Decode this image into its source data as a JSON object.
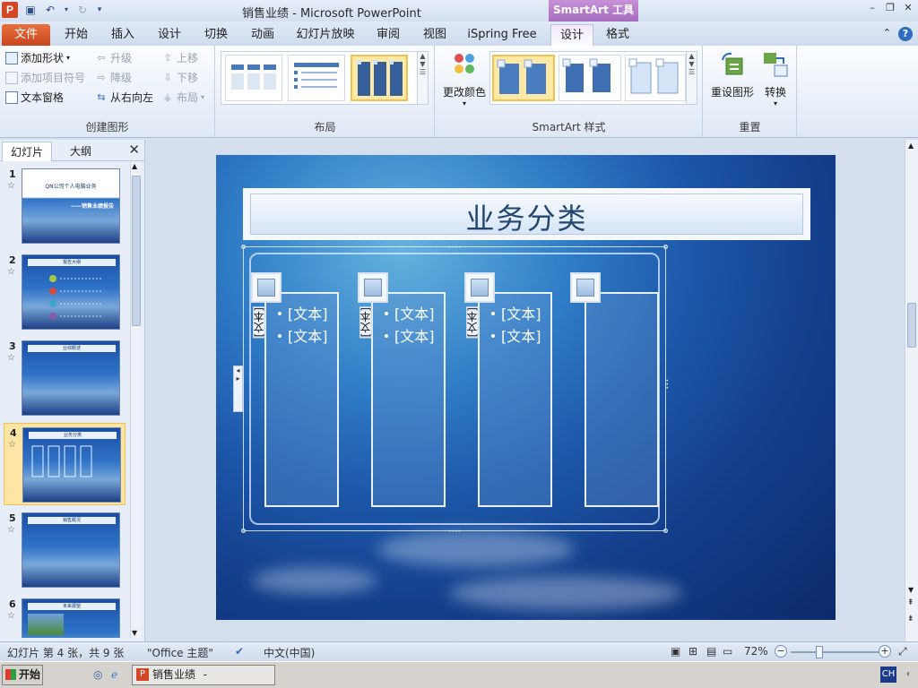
{
  "app_icon_letter": "P",
  "window_title": "销售业绩 - Microsoft PowerPoint",
  "context_tab_header": "SmartArt 工具",
  "tabs": [
    "文件",
    "开始",
    "插入",
    "设计",
    "切换",
    "动画",
    "幻灯片放映",
    "审阅",
    "视图",
    "iSpring Free",
    "设计",
    "格式"
  ],
  "ribbon": {
    "create_graphic": {
      "label": "创建图形",
      "add_shape": "添加形状",
      "add_bullet": "添加项目符号",
      "text_pane": "文本窗格",
      "promote": "升级",
      "demote": "降级",
      "right_to_left": "从右向左",
      "move_up": "上移",
      "move_down": "下移",
      "layout": "布局"
    },
    "layouts_label": "布局",
    "change_colors": "更改颜色",
    "styles_label": "SmartArt 样式",
    "reset_label": "重置",
    "reset_graphic": "重设图形",
    "convert": "转换"
  },
  "pane": {
    "tab_slides": "幻灯片",
    "tab_outline": "大纲",
    "close": "✕",
    "slides": [
      {
        "num": "1",
        "title": "QN公司个人电脑业务",
        "subtitle": "——销售业绩报告"
      },
      {
        "num": "2",
        "title": "报告大纲"
      },
      {
        "num": "3",
        "title": "业绩概述"
      },
      {
        "num": "4",
        "title": "业务分类"
      },
      {
        "num": "5",
        "title": "销售概况"
      },
      {
        "num": "6",
        "title": "未来展望"
      }
    ]
  },
  "slide": {
    "title": "业务分类",
    "smartart": {
      "columns": [
        {
          "vertical_text": "[文本]",
          "bullets": [
            "[文本]",
            "[文本]"
          ]
        },
        {
          "vertical_text": "[文本]",
          "bullets": [
            "[文本]",
            "[文本]"
          ]
        },
        {
          "vertical_text": "[文本]",
          "bullets": [
            "[文本]",
            "[文本]"
          ]
        },
        {
          "vertical_text": "",
          "bullets": []
        }
      ]
    }
  },
  "status": {
    "slide_info": "幻灯片 第 4 张，共 9 张",
    "theme": "\"Office 主题\"",
    "language": "中文(中国)",
    "zoom": "72%",
    "zoom_minus": "−",
    "zoom_plus": "+"
  },
  "taskbar": {
    "start": "开始",
    "task": "销售业绩 - Microsof...",
    "ime": "CH"
  },
  "colors": {
    "file_tab": "#d04a22",
    "context_tab": "#b27cc9",
    "slide_bg": "#1c56a8"
  }
}
